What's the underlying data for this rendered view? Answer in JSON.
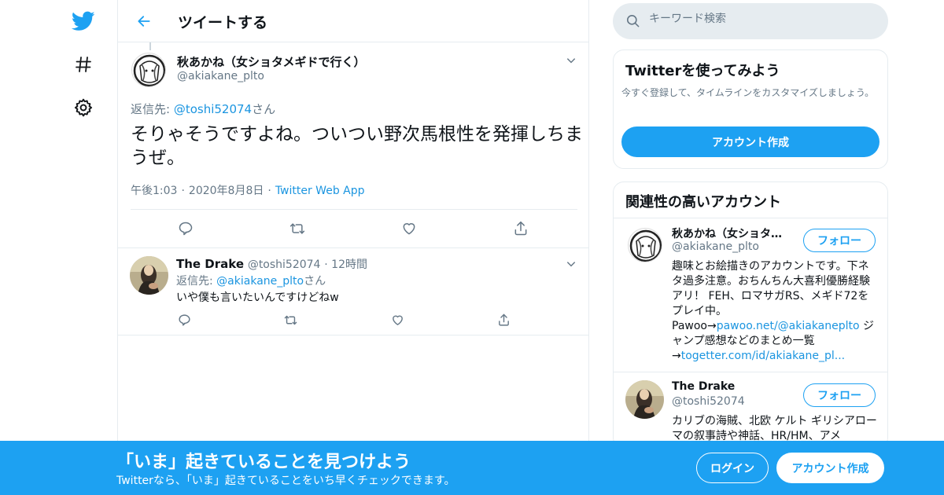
{
  "colors": {
    "accent": "#1da1f2",
    "link": "#1b95e0",
    "grey_text": "#657786",
    "border": "#e6ecf0"
  },
  "nav": {
    "icons": [
      "twitter-logo-icon",
      "hashtag-icon",
      "gear-icon"
    ]
  },
  "header": {
    "title": "ツイートする"
  },
  "tweet": {
    "name": "秋あかね（女ショタメギドで行く）",
    "handle": "@akiakane_plto",
    "reply_prefix": "返信先: ",
    "reply_to": "@toshi52074",
    "reply_suffix": "さん",
    "text": "そりゃそうですよね。ついつい野次馬根性を発揮しちまうぜ。",
    "time": "午後1:03",
    "date": "2020年8月8日",
    "source": "Twitter Web App"
  },
  "reply": {
    "name": "The Drake",
    "handle": "@toshi52074",
    "time": "12時間",
    "reply_prefix": "返信先: ",
    "reply_to": "@akiakane_plto",
    "reply_suffix": "さん",
    "text": "いや僕も言いたいんですけどねw"
  },
  "search": {
    "placeholder": "キーワード検索"
  },
  "signup_card": {
    "title": "Twitterを使ってみよう",
    "desc": "今すぐ登録して、タイムラインをカスタマイズしましょう。",
    "button": "アカウント作成"
  },
  "related": {
    "title": "関連性の高いアカウント",
    "accounts": [
      {
        "name": "秋あかね（女ショタ…",
        "handle": "@akiakane_plto",
        "follow": "フォロー",
        "bio1": "趣味とお絵描きのアカウントです。下ネタ過多注意。おちんちん大喜利優勝経験アリ！ FEH、ロマサガRS、メギド72をプレイ中。",
        "bio2_prefix": "Pawoo→",
        "bio2_link": "pawoo.net/@akiakaneplto",
        "bio2_suffix": " ジャンプ感想などのまとめ一覧",
        "bio3_prefix": "→",
        "bio3_link": "togetter.com/id/akiakane_pl..."
      },
      {
        "name": "The Drake",
        "handle": "@toshi52074",
        "follow": "フォロー",
        "bio": "カリブの海賊、北欧 ケルト ギリシアローマの叙事詩や神話、HR/HM、アメ"
      }
    ]
  },
  "bottom_bar": {
    "title": "「いま」起きていることを見つけよう",
    "subtitle": "Twitterなら、「いま」起きていることをいち早くチェックできます。",
    "login": "ログイン",
    "signup": "アカウント作成"
  }
}
